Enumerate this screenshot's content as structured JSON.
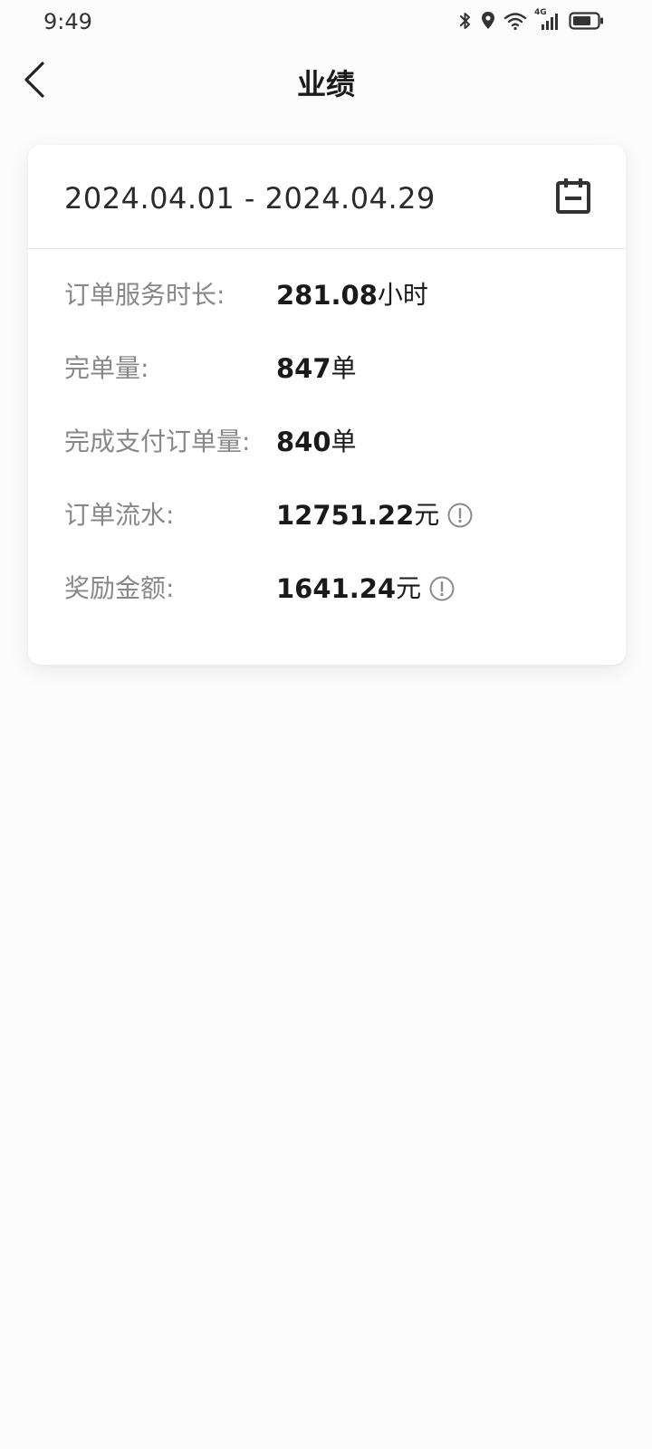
{
  "status_bar": {
    "time": "9:49",
    "icons": [
      "bluetooth-icon",
      "location-icon",
      "wifi-icon",
      "signal-4g-icon",
      "battery-icon"
    ],
    "network_label": "4G"
  },
  "header": {
    "title": "业绩",
    "back_icon": "chevron-left-icon"
  },
  "card": {
    "date_range": "2024.04.01 - 2024.04.29",
    "calendar_icon": "calendar-icon",
    "stats": [
      {
        "label": "订单服务时长:",
        "value": "281.08",
        "unit": "小时",
        "info": false
      },
      {
        "label": "完单量:",
        "value": "847",
        "unit": "单",
        "info": false
      },
      {
        "label": "完成支付订单量:",
        "value": "840",
        "unit": "单",
        "info": false
      },
      {
        "label": "订单流水:",
        "value": "12751.22",
        "unit": "元",
        "info": true
      },
      {
        "label": "奖励金额:",
        "value": "1641.24",
        "unit": "元",
        "info": true
      }
    ]
  },
  "colors": {
    "background": "#fcfcfc",
    "card": "#ffffff",
    "label": "#888888",
    "value": "#1a1a1a",
    "divider": "#e8e8e8"
  }
}
